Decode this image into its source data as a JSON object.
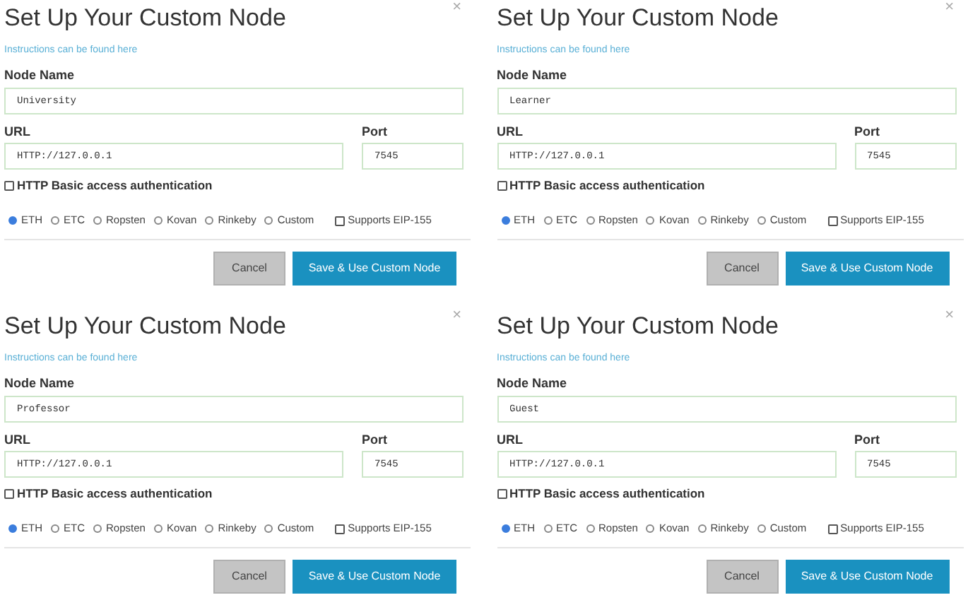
{
  "panels": [
    {
      "title": "Set Up Your Custom Node",
      "close": "×",
      "link": "Instructions can be found here",
      "node_name_label": "Node Name",
      "node_name": "University",
      "url_label": "URL",
      "url": "HTTP://127.0.0.1",
      "port_label": "Port",
      "port": "7545",
      "auth": {
        "label": "HTTP Basic access authentication",
        "checked": false
      },
      "networks": [
        {
          "label": "ETH",
          "selected": true
        },
        {
          "label": "ETC",
          "selected": false
        },
        {
          "label": "Ropsten",
          "selected": false
        },
        {
          "label": "Kovan",
          "selected": false
        },
        {
          "label": "Rinkeby",
          "selected": false
        },
        {
          "label": "Custom",
          "selected": false
        }
      ],
      "eip": {
        "label": "Supports EIP-155",
        "checked": false
      },
      "buttons": [
        "Cancel",
        "Save & Use Custom Node"
      ]
    },
    {
      "title": "Set Up Your Custom Node",
      "close": "×",
      "link": "Instructions can be found here",
      "node_name_label": "Node Name",
      "node_name": "Learner",
      "url_label": "URL",
      "url": "HTTP://127.0.0.1",
      "port_label": "Port",
      "port": "7545",
      "auth": {
        "label": "HTTP Basic access authentication",
        "checked": false
      },
      "networks": [
        {
          "label": "ETH",
          "selected": true
        },
        {
          "label": "ETC",
          "selected": false
        },
        {
          "label": "Ropsten",
          "selected": false
        },
        {
          "label": "Kovan",
          "selected": false
        },
        {
          "label": "Rinkeby",
          "selected": false
        },
        {
          "label": "Custom",
          "selected": false
        }
      ],
      "eip": {
        "label": "Supports EIP-155",
        "checked": false
      },
      "buttons": [
        "Cancel",
        "Save & Use Custom Node"
      ]
    },
    {
      "title": "Set Up Your Custom Node",
      "close": "×",
      "link": "Instructions can be found here",
      "node_name_label": "Node Name",
      "node_name": "Professor",
      "url_label": "URL",
      "url": "HTTP://127.0.0.1",
      "port_label": "Port",
      "port": "7545",
      "auth": {
        "label": "HTTP Basic access authentication",
        "checked": false
      },
      "networks": [
        {
          "label": "ETH",
          "selected": true
        },
        {
          "label": "ETC",
          "selected": false
        },
        {
          "label": "Ropsten",
          "selected": false
        },
        {
          "label": "Kovan",
          "selected": false
        },
        {
          "label": "Rinkeby",
          "selected": false
        },
        {
          "label": "Custom",
          "selected": false
        }
      ],
      "eip": {
        "label": "Supports EIP-155",
        "checked": false
      },
      "buttons": [
        "Cancel",
        "Save & Use Custom Node"
      ]
    },
    {
      "title": "Set Up Your Custom Node",
      "close": "×",
      "link": "Instructions can be found here",
      "node_name_label": "Node Name",
      "node_name": "Guest",
      "url_label": "URL",
      "url": "HTTP://127.0.0.1",
      "port_label": "Port",
      "port": "7545",
      "auth": {
        "label": "HTTP Basic access authentication",
        "checked": false
      },
      "networks": [
        {
          "label": "ETH",
          "selected": true
        },
        {
          "label": "ETC",
          "selected": false
        },
        {
          "label": "Ropsten",
          "selected": false
        },
        {
          "label": "Kovan",
          "selected": false
        },
        {
          "label": "Rinkeby",
          "selected": false
        },
        {
          "label": "Custom",
          "selected": false
        }
      ],
      "eip": {
        "label": "Supports EIP-155",
        "checked": false
      },
      "buttons": [
        "Cancel",
        "Save & Use Custom Node"
      ]
    }
  ]
}
